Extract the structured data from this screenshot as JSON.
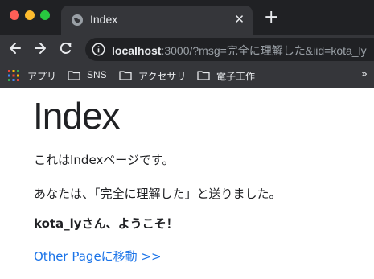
{
  "browser": {
    "tab": {
      "title": "Index",
      "close_glyph": "✕",
      "icon": "globe-icon"
    },
    "new_tab_glyph": "+",
    "url": {
      "host": "localhost",
      "rest": ":3000/?msg=完全に理解した&iid=kota_ly"
    },
    "bookmarks": [
      {
        "label": "アプリ",
        "icon": "apps-grid-icon"
      },
      {
        "label": "SNS",
        "icon": "folder-icon"
      },
      {
        "label": "アクセサリ",
        "icon": "folder-icon"
      },
      {
        "label": "電子工作",
        "icon": "folder-icon"
      }
    ],
    "bookmarks_more": "»",
    "colors": {
      "frame": "#202124",
      "toolbar": "#35363a",
      "tab_text": "#e8eaed"
    }
  },
  "page": {
    "heading": "Index",
    "intro": "これはIndexページです。",
    "message": "あなたは、「完全に理解した」と送りました。",
    "greeting": "kota_lyさん、ようこそ！",
    "link": "Other Pageに移動 >>",
    "colors": {
      "text": "#202124",
      "link": "#1a73e8"
    }
  }
}
